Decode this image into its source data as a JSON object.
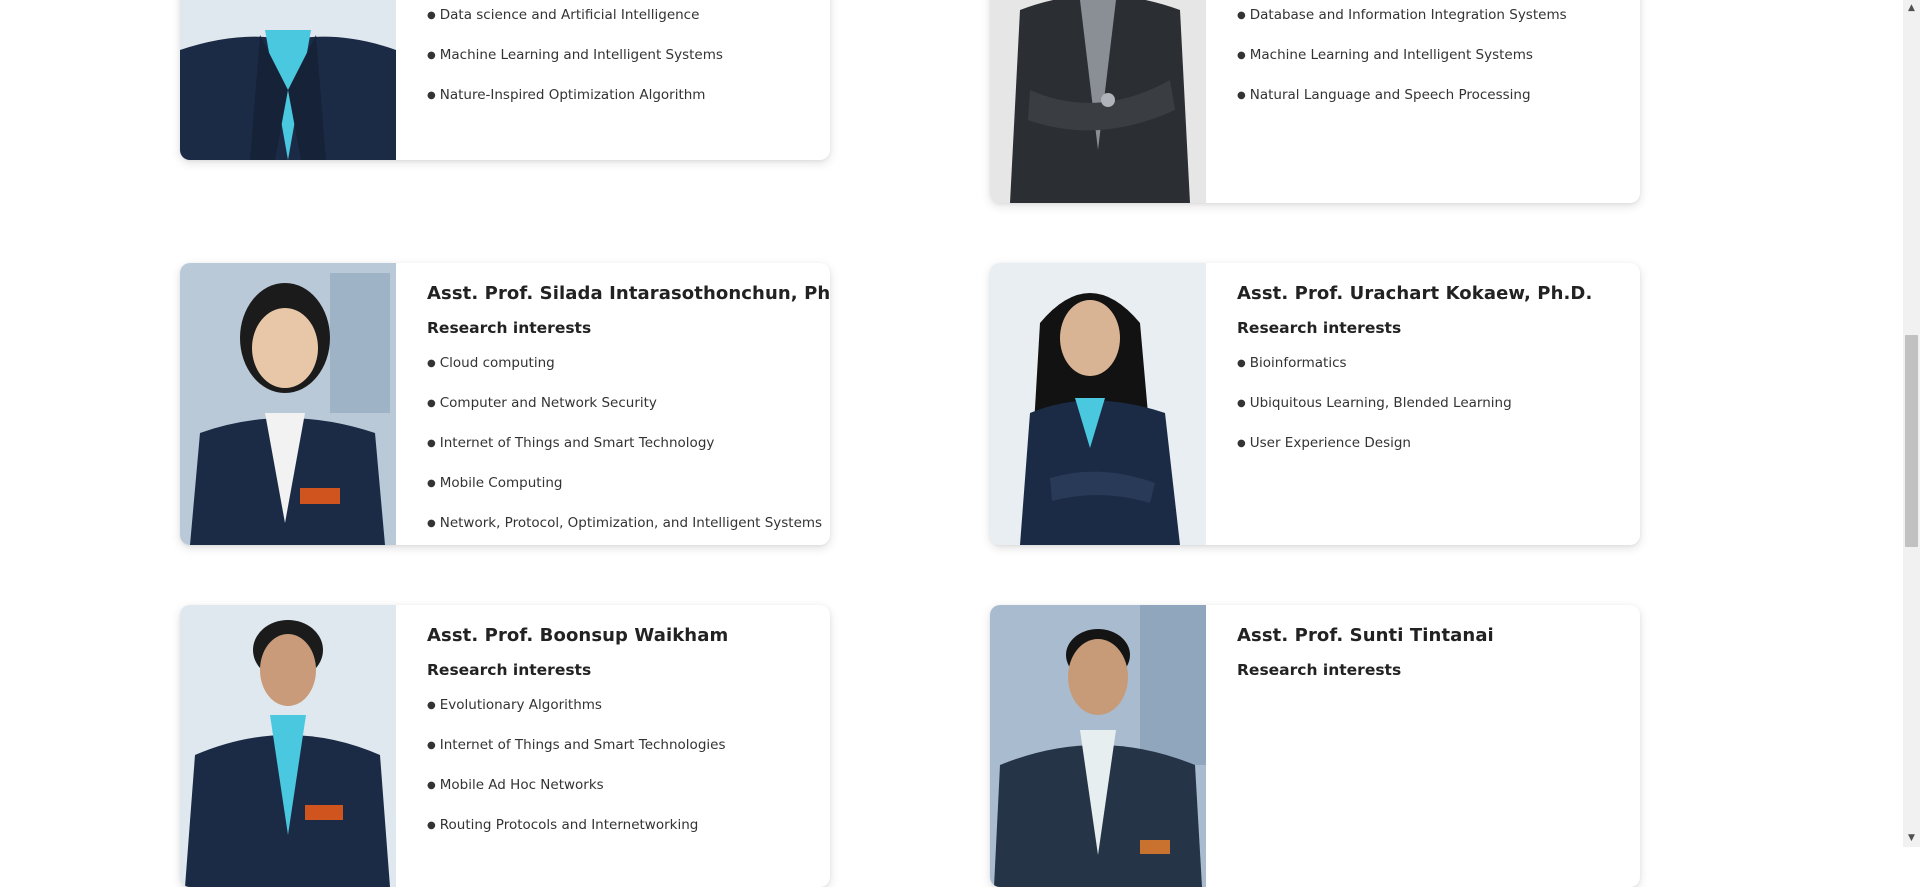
{
  "colors": {
    "page_bg": "#ffffff",
    "card_bg": "#ffffff",
    "text": "#2a2a2a",
    "shirt_cyan": "#49c8df",
    "suit_navy": "#1c2b45"
  },
  "cards": [
    {
      "name": "",
      "heading": "",
      "interests": [
        "Data science and Artificial Intelligence",
        "Machine Learning and Intelligent Systems",
        "Nature-Inspired Optimization Algorithm"
      ]
    },
    {
      "name": "",
      "heading": "",
      "interests": [
        "Database and Information Integration Systems",
        "Machine Learning and Intelligent Systems",
        "Natural Language and Speech Processing"
      ]
    },
    {
      "name": "Asst. Prof. Silada Intarasothonchun, Ph.D.",
      "heading": "Research interests",
      "interests": [
        "Cloud computing",
        "Computer and Network Security",
        "Internet of Things and Smart Technology",
        "Mobile Computing",
        "Network, Protocol, Optimization, and Intelligent Systems"
      ]
    },
    {
      "name": "Asst. Prof. Urachart Kokaew, Ph.D.",
      "heading": "Research interests",
      "interests": [
        "Bioinformatics",
        "Ubiquitous Learning, Blended Learning",
        "User Experience Design"
      ]
    },
    {
      "name": "Asst. Prof. Boonsup Waikham",
      "heading": "Research interests",
      "interests": [
        "Evolutionary Algorithms",
        "Internet of Things and Smart Technologies",
        "Mobile Ad Hoc Networks",
        "Routing Protocols and Internetworking"
      ]
    },
    {
      "name": "Asst. Prof. Sunti Tintanai",
      "heading": "Research interests",
      "interests": []
    }
  ],
  "scrollbar": {
    "up_icon": "triangle-up-icon",
    "down_icon": "triangle-down-icon"
  }
}
